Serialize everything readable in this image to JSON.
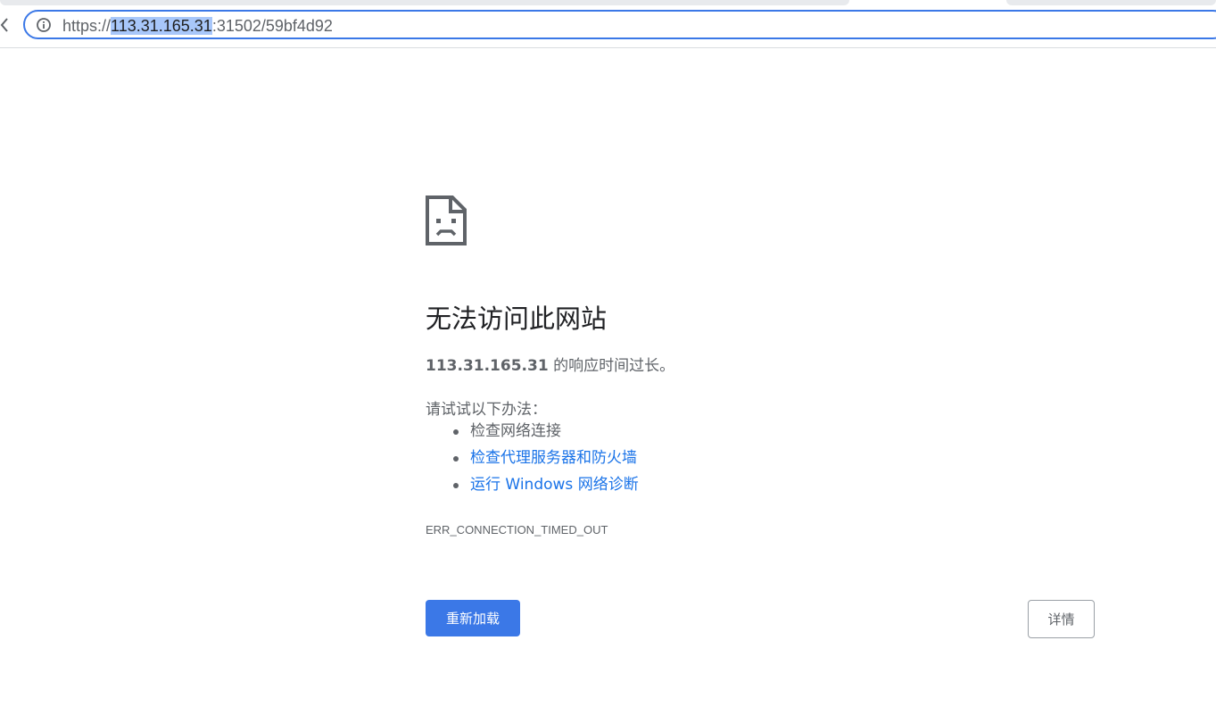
{
  "toolbar": {
    "url_scheme": "https://",
    "url_host": "113.31.165.31",
    "url_rest": ":31502/59bf4d92",
    "icons": {
      "back": "back-arrow-icon",
      "info": "info-icon"
    }
  },
  "error_page": {
    "icon": "sad-page-icon",
    "title": "无法访问此网站",
    "summary_host": "113.31.165.31",
    "summary_text": " 的响应时间过长。",
    "suggestions_intro": "请试试以下办法：",
    "suggestions": [
      {
        "label": "检查网络连接",
        "is_link": false
      },
      {
        "label": "检查代理服务器和防火墙",
        "is_link": true
      },
      {
        "label": "运行 Windows 网络诊断",
        "is_link": true
      }
    ],
    "error_code": "ERR_CONNECTION_TIMED_OUT",
    "reload_label": "重新加载",
    "details_label": "详情"
  },
  "colors": {
    "accent": "#3b78e7",
    "link": "#1a73e8",
    "text_primary": "#202124",
    "text_secondary": "#5f6368",
    "url_selection": "#a8c7fa"
  }
}
